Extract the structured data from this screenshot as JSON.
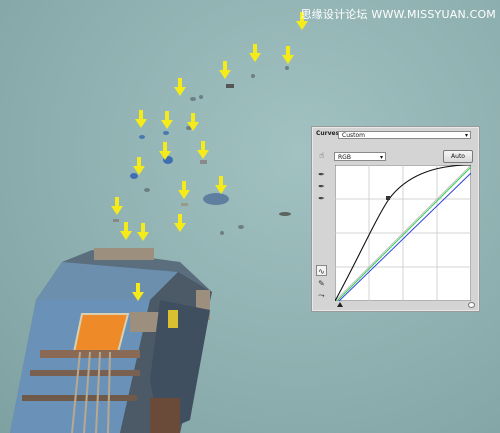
{
  "watermark": "思缘设计论坛 WWW.MISSYUAN.COM",
  "curves_panel": {
    "title": "Curves",
    "preset_value": "Custom",
    "channel_value": "RGB",
    "auto_label": "Auto"
  },
  "colors": {
    "arrow": "#f5ea1a",
    "background": "#93b3b3",
    "curve_rgb": "#111111",
    "curve_green": "#33cc55",
    "curve_blue": "#3344dd"
  },
  "icons": [
    "hand-adjust-icon",
    "black-eyedropper-icon",
    "gray-eyedropper-icon",
    "white-eyedropper-icon",
    "curve-tool-icon",
    "pencil-icon",
    "smooth-icon"
  ]
}
